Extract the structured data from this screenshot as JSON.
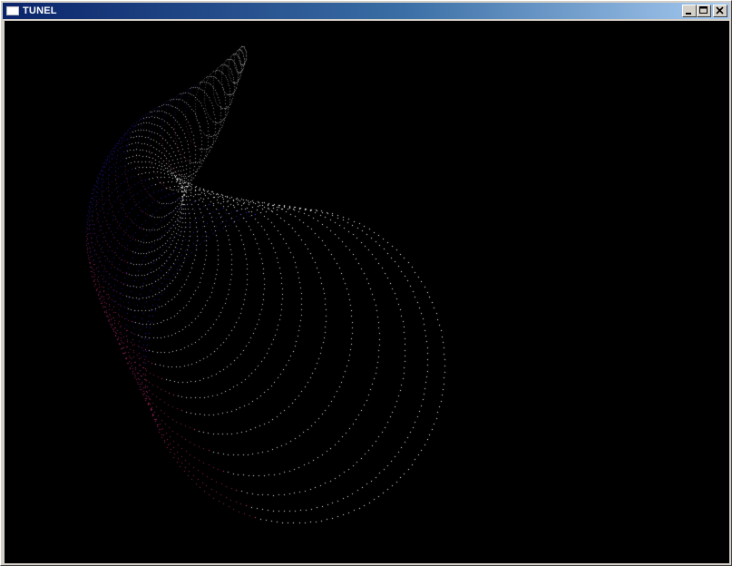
{
  "window": {
    "title": "TUNEL",
    "icon": "application-window-icon"
  },
  "caption_buttons": [
    {
      "name": "minimize",
      "icon": "minimize-icon"
    },
    {
      "name": "maximize",
      "icon": "maximize-icon"
    },
    {
      "name": "close",
      "icon": "close-icon"
    }
  ],
  "render": {
    "background": "#000000",
    "ring_color": "#ffffff",
    "ring_shadow_color": "#3a2cff",
    "ring_accent_color": "#ff3a9a"
  }
}
